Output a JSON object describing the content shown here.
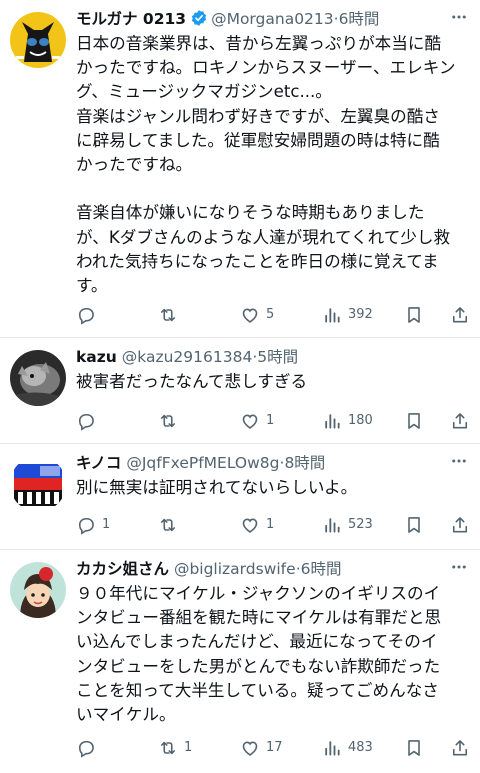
{
  "posts": [
    {
      "display_name": "モルガナ 0213",
      "handle": "@Morgana0213",
      "time": "·6時間",
      "verified": true,
      "text_lines": [
        "日本の音楽業界は、昔から左翼っぷりが本当に酷",
        "かったですね。ロキノンからスヌーザー、エレキン",
        "グ、ミュージックマガジンetc...。",
        "音楽はジャンル問わず好きですが、左翼臭の酷さ",
        "に辟易してました。従軍慰安婦問題の時は特に酷",
        "かったですね。",
        "",
        "音楽自体が嫌いになりそうな時期もありました",
        "が、Kダブさんのような人達が現れてくれて少し救",
        "われた気持ちになったことを昨日の様に覚えてま",
        "す。"
      ],
      "replies": "",
      "reposts": "",
      "likes": "5",
      "views": "392"
    },
    {
      "display_name": "kazu",
      "handle": "@kazu29161384",
      "time": "·5時間",
      "verified": false,
      "text_lines": [
        "被害者だったなんて悲しすぎる"
      ],
      "replies": "",
      "reposts": "",
      "likes": "1",
      "views": "180"
    },
    {
      "display_name": "キノコ",
      "handle": "@JqfFxePfMELOw8g",
      "time": "·8時間",
      "verified": false,
      "text_lines": [
        "別に無実は証明されてないらしいよ。"
      ],
      "replies": "1",
      "reposts": "",
      "likes": "1",
      "views": "523"
    },
    {
      "display_name": "カカシ姐さん",
      "handle": "@biglizardswife",
      "time": "·6時間",
      "verified": false,
      "text_lines": [
        "９０年代にマイケル・ジャクソンのイギリスのイ",
        "ンタビュー番組を観た時にマイケルは有罪だと思",
        "い込んでしまったんだけど、最近になってそのイ",
        "ンタビューをした男がとんでもない詐欺師だった",
        "ことを知って大半生している。疑ってごめんなさ",
        "いマイケル。"
      ],
      "replies": "",
      "reposts": "1",
      "likes": "17",
      "views": "483"
    }
  ],
  "colors": {
    "text": "#0f1419",
    "secondary": "#536471",
    "verified": "#1d9bf0",
    "divider": "#e6e9ec"
  },
  "icons": {
    "reply": "reply-icon",
    "repost": "repost-icon",
    "like": "heart-icon",
    "views": "views-icon",
    "bookmark": "bookmark-icon",
    "share": "share-icon",
    "more": "more-icon",
    "verified": "verified-badge-icon"
  }
}
